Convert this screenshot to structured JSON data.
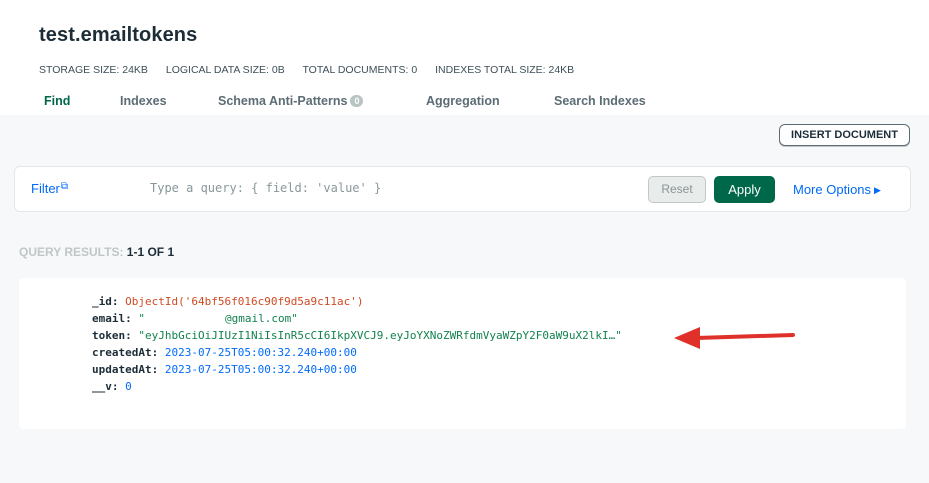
{
  "collection": {
    "title": "test.emailtokens",
    "stats": {
      "storage_size": "STORAGE SIZE: 24KB",
      "logical_size": "LOGICAL DATA SIZE: 0B",
      "total_docs": "TOTAL DOCUMENTS: 0",
      "indexes_size": "INDEXES TOTAL SIZE: 24KB"
    }
  },
  "tabs": [
    {
      "label": "Find",
      "active": true
    },
    {
      "label": "Indexes"
    },
    {
      "label": "Schema Anti-Patterns",
      "badge": "0"
    },
    {
      "label": "Aggregation"
    },
    {
      "label": "Search Indexes"
    }
  ],
  "actions": {
    "insert_document": "INSERT DOCUMENT"
  },
  "query_bar": {
    "filter_label": "Filter",
    "placeholder": "Type a query: { field: 'value' }",
    "reset": "Reset",
    "apply": "Apply",
    "more_options": "More Options"
  },
  "results": {
    "label_prefix": "QUERY RESULTS: ",
    "range": "1-1 OF 1"
  },
  "document": {
    "id_key": "_id:",
    "id_value": "ObjectId('64bf56f016c90f9d5a9c11ac')",
    "email_key": "email:",
    "email_prefix": "\"",
    "email_suffix": "@gmail.com\"",
    "token_key": "token:",
    "token_value": "\"eyJhbGciOiJIUzI1NiIsInR5cCI6IkpXVCJ9.eyJoYXNoZWRfdmVyaWZpY2F0aW9uX2lkI…\"",
    "created_key": "createdAt:",
    "created_value": "2023-07-25T05:00:32.240+00:00",
    "updated_key": "updatedAt:",
    "updated_value": "2023-07-25T05:00:32.240+00:00",
    "v_key": "__v:",
    "v_value": "0"
  },
  "colors": {
    "accent_green": "#00684a",
    "link_blue": "#016bf8",
    "annotation_red": "#e0302a"
  }
}
